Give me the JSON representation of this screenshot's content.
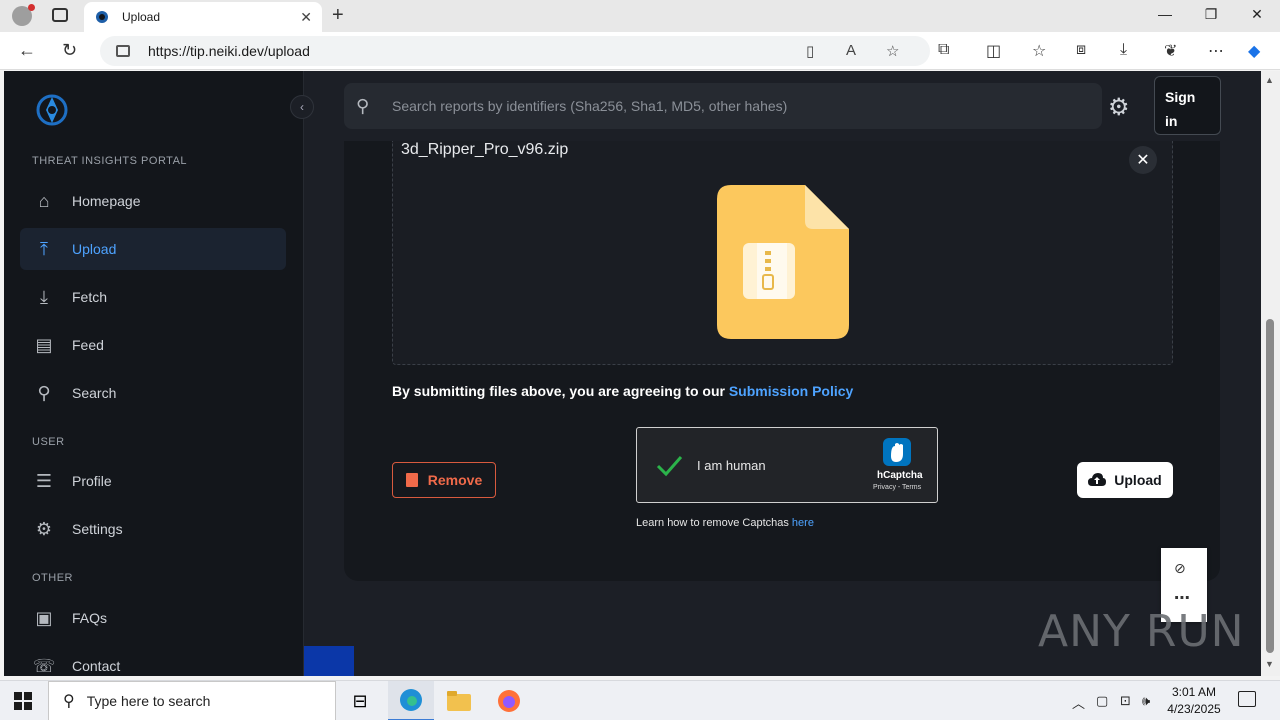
{
  "browser": {
    "tab_title": "Upload",
    "url": "https://tip.neiki.dev/upload"
  },
  "sidebar": {
    "sections": {
      "portal": "THREAT INSIGHTS PORTAL",
      "user": "USER",
      "other": "OTHER"
    },
    "items": [
      {
        "label": "Homepage",
        "icon": "home-icon",
        "active": false
      },
      {
        "label": "Upload",
        "icon": "upload-icon",
        "active": true
      },
      {
        "label": "Fetch",
        "icon": "download-icon",
        "active": false
      },
      {
        "label": "Feed",
        "icon": "feed-icon",
        "active": false
      },
      {
        "label": "Search",
        "icon": "search-icon",
        "active": false
      },
      {
        "label": "Profile",
        "icon": "profile-icon",
        "active": false
      },
      {
        "label": "Settings",
        "icon": "gear-icon",
        "active": false
      },
      {
        "label": "FAQs",
        "icon": "faq-icon",
        "active": false
      },
      {
        "label": "Contact",
        "icon": "contact-icon",
        "active": false
      }
    ]
  },
  "header": {
    "search_placeholder": "Search reports by identifiers (Sha256, Sha1, MD5, other hahes)",
    "signin_label": "Sign in"
  },
  "upload": {
    "filename": "3d_Ripper_Pro_v96.zip",
    "agreement_text": "By submitting files above, you are agreeing to our ",
    "policy_link": "Submission Policy",
    "remove_label": "Remove",
    "upload_label": "Upload",
    "captcha": {
      "label": "I am human",
      "brand": "hCaptcha",
      "terms": "Privacy - Terms",
      "learn_text": "Learn how to remove Captchas ",
      "learn_link": "here"
    }
  },
  "watermark": "ANY RUN",
  "taskbar": {
    "search_placeholder": "Type here to search",
    "time": "3:01 AM",
    "date": "4/23/2025"
  },
  "colors": {
    "accent": "#4ea3ff",
    "remove": "#f06a4a",
    "zip_icon": "#fcc85d"
  }
}
